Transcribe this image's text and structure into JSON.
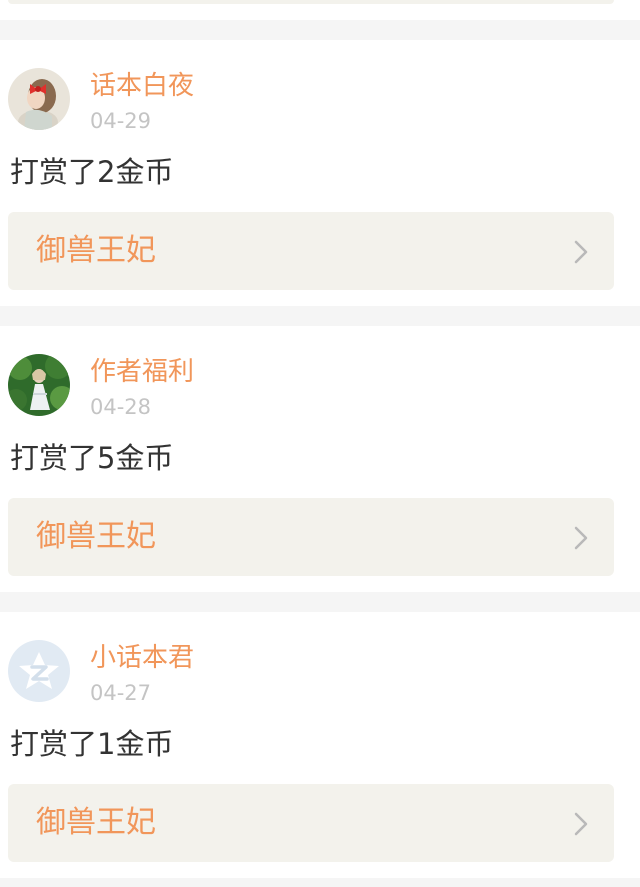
{
  "colors": {
    "accent": "#f1965a",
    "date": "#c4c4c4",
    "text": "#333333",
    "card_background": "#f3f2ec",
    "page_background": "#f5f5f5"
  },
  "feed": [
    {
      "username": "话本白夜",
      "date": "04-29",
      "action": "打赏了2金币",
      "book_title": "御兽王妃",
      "avatar_icon": "girl-with-red-bow-avatar"
    },
    {
      "username": "作者福利",
      "date": "04-28",
      "action": "打赏了5金币",
      "book_title": "御兽王妃",
      "avatar_icon": "girl-in-forest-avatar"
    },
    {
      "username": "小话本君",
      "date": "04-27",
      "action": "打赏了1金币",
      "book_title": "御兽王妃",
      "avatar_icon": "default-star-avatar"
    }
  ]
}
